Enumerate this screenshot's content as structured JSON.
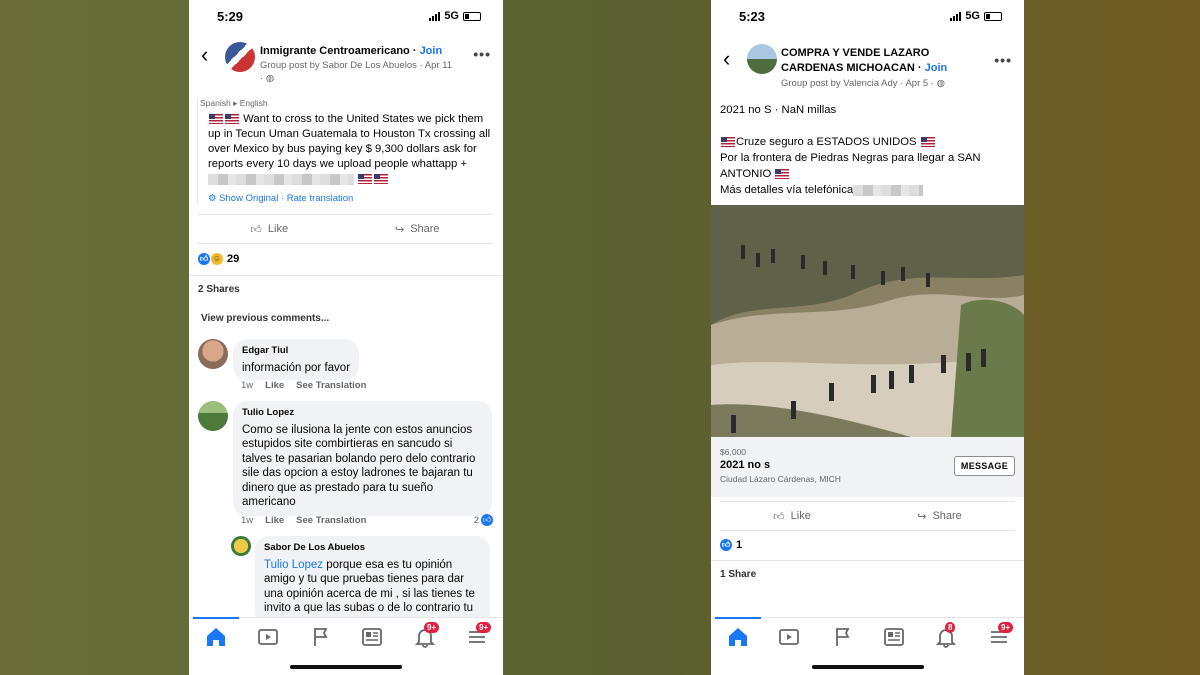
{
  "left": {
    "status": {
      "time": "5:29",
      "network": "5G"
    },
    "header": {
      "group_name": "Inmigrante Centroamericano",
      "join": "Join",
      "sub_line": "Group post by Sabor De Los Abuelos · Apr 11",
      "sub_line2": "·"
    },
    "translation": {
      "from": "Spanish",
      "arrow": "▸",
      "to": "English"
    },
    "post_text": "Want to cross to the United States we pick them up in Tecun Uman Guatemala to Houston Tx crossing all over Mexico by bus paying key $ 9,300 dollars ask for reports every 10 days we upload people whattapp +",
    "show_original": "Show Original",
    "rate_translation": "Rate translation",
    "actions": {
      "like": "Like",
      "share": "Share"
    },
    "reaction_count": "29",
    "shares": "2 Shares",
    "view_previous": "View previous comments...",
    "comments": [
      {
        "name": "Edgar Tiul",
        "text": "información por favor",
        "time": "1w",
        "like": "Like",
        "translate": "See Translation"
      },
      {
        "name": "Tulio Lopez",
        "text": "Como se ilusiona la jente con estos anuncios estupidos site combirtieras en sancudo si talves te pasarian bolando pero delo contrario sile das opcion a estoy ladrones te bajaran tu dinero que as prestado para tu sueño americano",
        "time": "1w",
        "like": "Like",
        "translate": "See Translation",
        "reactions": "2"
      },
      {
        "name": "Sabor De Los Abuelos",
        "mention": "Tulio Lopez",
        "text": " porque esa es tu opinión amigo y tu que pruebas tienes para dar una opinión acerca de mi , si las tienes te invito a que las subas o de lo contrario tu serías un bocón más"
      }
    ],
    "tabs": {
      "notif_badge": "9+",
      "menu_badge": "9+"
    }
  },
  "right": {
    "status": {
      "time": "5:23",
      "network": "5G"
    },
    "header": {
      "group_name_1": "COMPRA Y VENDE LAZARO",
      "group_name_2": "CARDENAS MICHOACAN",
      "join": "Join",
      "sub_line": "Group post by Valencia Ady · Apr 5 ·"
    },
    "listing_line": "2021 no  S · NaN millas",
    "body_1": "Cruze seguro a ESTADOS UNIDOS",
    "body_2": "Por la frontera de Piedras Negras para llegar a SAN",
    "body_3": "ANTONIO",
    "body_4": "Más detalles vía telefónica",
    "price": "$6,000",
    "title": "2021 no s",
    "location": "Ciudad Lázaro Cárdenas, MICH",
    "message_btn": "MESSAGE",
    "actions": {
      "like": "Like",
      "share": "Share"
    },
    "reaction_count": "1",
    "shares": "1 Share",
    "tabs": {
      "notif_badge": "8",
      "menu_badge": "9+"
    }
  },
  "colors": {
    "fb_blue": "#1877f2",
    "badge_red": "#e41e3f",
    "bubble_gray": "#f0f2f5"
  },
  "icons": [
    "back-arrow-icon",
    "more-dots-icon",
    "globe-icon",
    "like-thumb-icon",
    "share-arrow-icon",
    "home-icon",
    "video-icon",
    "flag-icon",
    "news-icon",
    "bell-icon",
    "menu-icon"
  ]
}
